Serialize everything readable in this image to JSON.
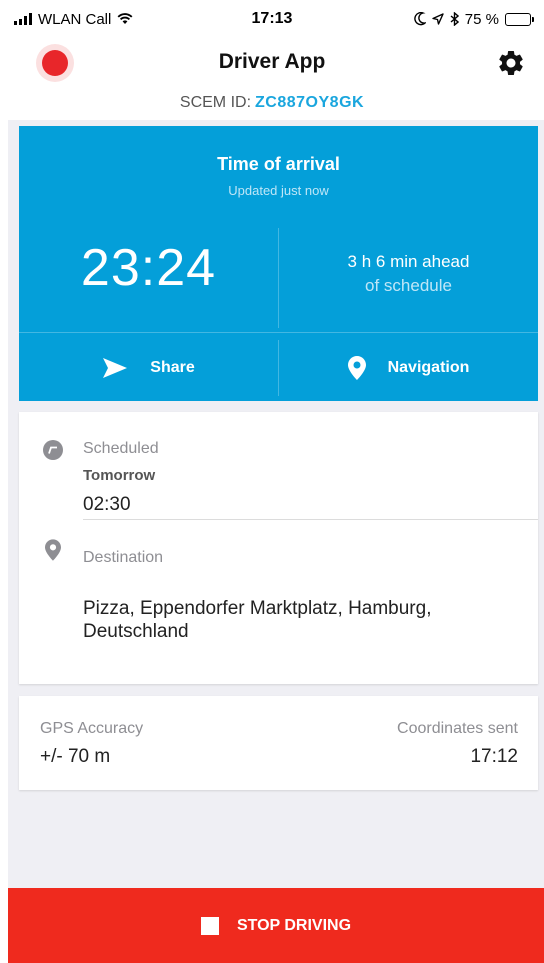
{
  "status_bar": {
    "carrier": "WLAN Call",
    "time": "17:13",
    "battery_text": "75 %",
    "battery_level": 0.75,
    "icons": [
      "signal-icon",
      "wifi-icon",
      "moon-icon",
      "location-arrow-icon",
      "bluetooth-icon",
      "battery-icon"
    ]
  },
  "header": {
    "title": "Driver App",
    "record_icon": "record-icon",
    "settings_icon": "gear-icon"
  },
  "scem": {
    "label": "SCEM ID:",
    "value": "ZC887OY8GK"
  },
  "eta_card": {
    "title": "Time of arrival",
    "updated": "Updated just now",
    "time": "23:24",
    "ahead_line1": "3 h 6 min ahead",
    "ahead_line2": "of schedule",
    "share_label": "Share",
    "navigation_label": "Navigation"
  },
  "schedule_card": {
    "scheduled_label": "Scheduled",
    "scheduled_day": "Tomorrow",
    "scheduled_time": "02:30",
    "destination_label": "Destination",
    "destination_line1": "Pizza, Eppendorfer Marktplatz, Hamburg,",
    "destination_line2": "Deutschland"
  },
  "gps_card": {
    "accuracy_label": "GPS Accuracy",
    "accuracy_value": "+/- 70 m",
    "coords_label": "Coordinates sent",
    "coords_value": "17:12"
  },
  "stop_button": {
    "label": "STOP DRIVING"
  },
  "colors": {
    "accent_blue": "#049fd9",
    "stop_red": "#ef2a1e",
    "record_red": "#e8262a",
    "background_grey": "#efeff4"
  }
}
